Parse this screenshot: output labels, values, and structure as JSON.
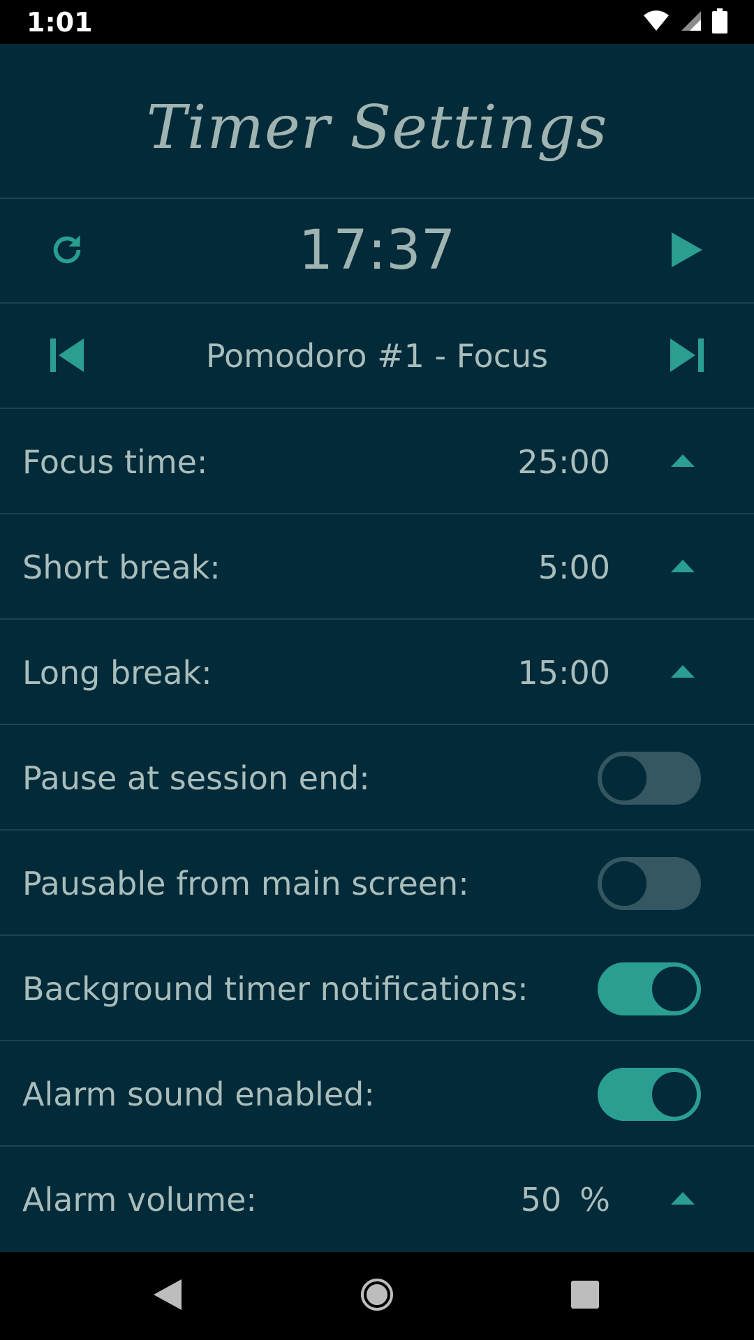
{
  "status_bar": {
    "time": "1:01",
    "icons": [
      "wifi-icon",
      "cellular-signal-icon",
      "battery-icon"
    ]
  },
  "header": {
    "title": "Timer Settings"
  },
  "timer": {
    "display": "17:37",
    "reset_icon": "refresh-icon",
    "play_icon": "play-icon"
  },
  "session": {
    "label": "Pomodoro #1 - Focus",
    "prev_icon": "skip-previous-icon",
    "next_icon": "skip-next-icon"
  },
  "settings": {
    "focus_time": {
      "label": "Focus time:",
      "value": "25:00"
    },
    "short_break": {
      "label": "Short break:",
      "value": "5:00"
    },
    "long_break": {
      "label": "Long break:",
      "value": "15:00"
    },
    "pause_at_session_end": {
      "label": "Pause at session end:",
      "enabled": false
    },
    "pausable_from_main": {
      "label": "Pausable from main screen:",
      "enabled": false
    },
    "background_notifications": {
      "label": "Background timer notifications:",
      "enabled": true
    },
    "alarm_sound": {
      "label": "Alarm sound enabled:",
      "enabled": true
    },
    "alarm_volume": {
      "label": "Alarm volume:",
      "value": "50",
      "unit": "%"
    }
  },
  "nav_bar": {
    "icons": [
      "back-icon",
      "home-icon",
      "recents-icon"
    ]
  },
  "colors": {
    "background": "#032a38",
    "accent": "#2a9e90",
    "text": "#a9bdbb",
    "divider": "#1d4350"
  }
}
